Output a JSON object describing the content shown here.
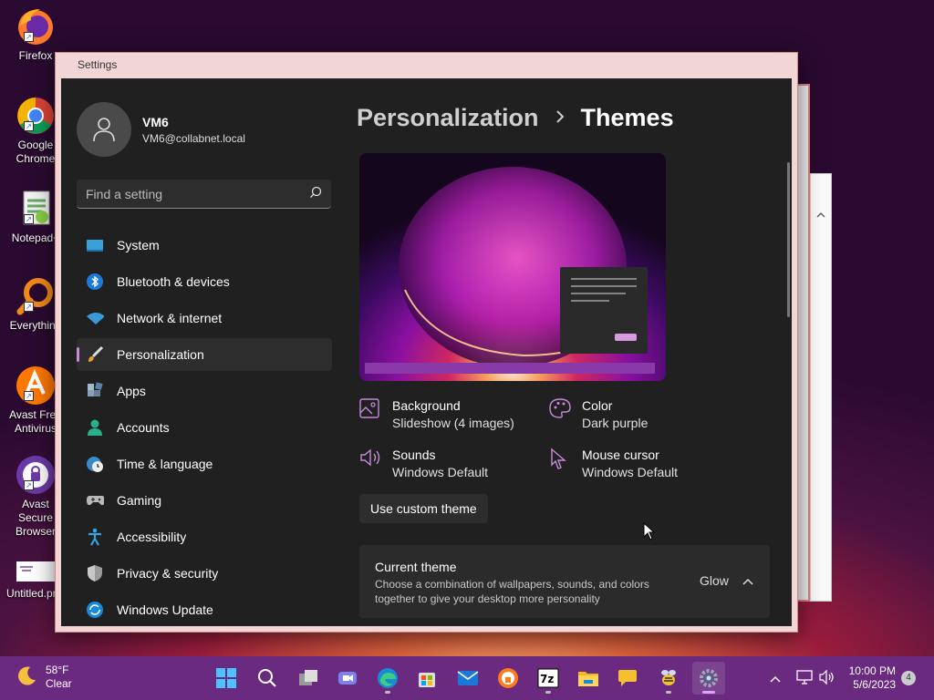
{
  "desktop": {
    "icons": [
      {
        "label": "Firefox"
      },
      {
        "label": "Google Chrome"
      },
      {
        "label": "Notepad+"
      },
      {
        "label": "Everything"
      },
      {
        "label": "Avast Free Antivirus"
      },
      {
        "label": "Avast Secure Browser"
      },
      {
        "label": "Untitled.png"
      }
    ]
  },
  "window": {
    "title": "Settings"
  },
  "profile": {
    "name": "VM6",
    "email": "VM6@collabnet.local"
  },
  "search": {
    "placeholder": "Find a setting"
  },
  "nav": {
    "items": [
      {
        "label": "System",
        "icon": "monitor-icon"
      },
      {
        "label": "Bluetooth & devices",
        "icon": "bluetooth-icon"
      },
      {
        "label": "Network & internet",
        "icon": "wifi-icon"
      },
      {
        "label": "Personalization",
        "icon": "paintbrush-icon",
        "active": true
      },
      {
        "label": "Apps",
        "icon": "apps-icon"
      },
      {
        "label": "Accounts",
        "icon": "person-icon"
      },
      {
        "label": "Time & language",
        "icon": "clock-globe-icon"
      },
      {
        "label": "Gaming",
        "icon": "gamepad-icon"
      },
      {
        "label": "Accessibility",
        "icon": "accessibility-icon"
      },
      {
        "label": "Privacy & security",
        "icon": "shield-icon"
      },
      {
        "label": "Windows Update",
        "icon": "update-icon"
      }
    ]
  },
  "main": {
    "breadcrumb_parent": "Personalization",
    "breadcrumb_current": "Themes",
    "properties": {
      "background": {
        "title": "Background",
        "value": "Slideshow (4 images)"
      },
      "color": {
        "title": "Color",
        "value": "Dark purple"
      },
      "sounds": {
        "title": "Sounds",
        "value": "Windows Default"
      },
      "mouse": {
        "title": "Mouse cursor",
        "value": "Windows Default"
      }
    },
    "custom_theme_label": "Use custom theme",
    "current_theme": {
      "title": "Current theme",
      "description": "Choose a combination of wallpapers, sounds, and colors together to give your desktop more personality",
      "value": "Glow"
    }
  },
  "taskbar": {
    "weather_temp": "58°F",
    "weather_cond": "Clear",
    "time": "10:00 PM",
    "date": "5/6/2023",
    "notification_count": "4",
    "apps": [
      "start-icon",
      "search-icon",
      "task-view-icon",
      "teams-chat-icon",
      "edge-icon",
      "store-icon",
      "mail-icon",
      "avast-browser-icon",
      "7zip-icon",
      "file-explorer-icon",
      "feedback-icon",
      "bee-app-icon",
      "settings-icon"
    ]
  },
  "colors": {
    "accent": "#c48bd8",
    "taskbar": "#6a2a80",
    "window_bg": "#202020"
  }
}
